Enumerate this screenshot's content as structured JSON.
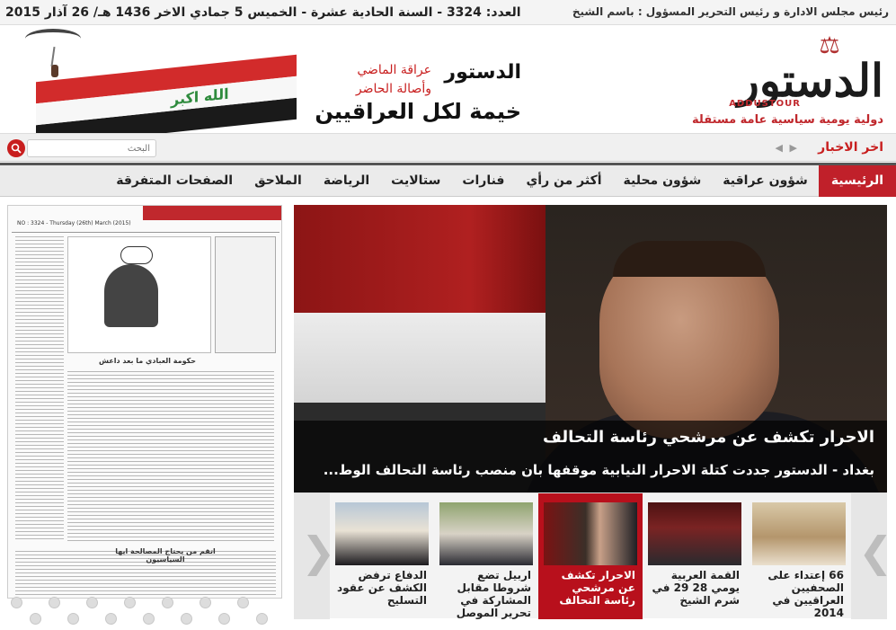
{
  "topbar": {
    "issue": "العدد: 3324 - السنة الحادية عشرة - الخميس 5 جمادي الاخر 1436 هـ/ 26 آذار 2015",
    "editor": "رئيس مجلس الادارة و رئيس التحرير المسؤول : باسم الشيخ"
  },
  "logo": {
    "main": "الدستور",
    "latin": "ADDUSTOUR",
    "tag": "دولية يومية سياسية عامة مستقلة"
  },
  "slogan": {
    "line1": "الدستور",
    "line2": "عراقة الماضي",
    "line3": "وأصالة الحاضر",
    "line4": "خيمة لكل العراقيين"
  },
  "banner": {
    "flag_text": "الله اكبر"
  },
  "ticker": {
    "label": "اخر الاخبار"
  },
  "search": {
    "placeholder": "البحث"
  },
  "nav": {
    "items": [
      {
        "label": "الرئيسية",
        "active": true
      },
      {
        "label": "شؤون عراقية"
      },
      {
        "label": "شؤون محلية"
      },
      {
        "label": "أكثر من رأي"
      },
      {
        "label": "فنارات"
      },
      {
        "label": "ستالايت"
      },
      {
        "label": "الرياضة"
      },
      {
        "label": "الملاحق"
      },
      {
        "label": "الصفحات المتفرقة"
      }
    ]
  },
  "paper": {
    "masthead": "NO : 3324 - Thursday (26th) March (2015)",
    "caption1": "حكومة العبادي ما بعد داعش",
    "caption2": "اتقم من يحتاج المصالحة ايها السياسيون"
  },
  "feature": {
    "title": "الاحرار تكشف عن مرشحي رئاسة التحالف",
    "excerpt": "بغداد - الدستور جددت كتلة الاحرار النيابية موقفها بان منصب رئاسة التحالف الوط..."
  },
  "carousel": {
    "items": [
      {
        "caption": "66 إعتداء على الصحفيين العراقيين في 2014"
      },
      {
        "caption": "القمة العربية يومي 28 29 في شرم الشيخ"
      },
      {
        "caption": "الاحرار تكشف عن مرشحي رئاسة التحالف",
        "active": true
      },
      {
        "caption": "اربيل تضع شروطا مقابل المشاركة في تحرير الموصل"
      },
      {
        "caption": "الدفاع ترفض الكشف عن عقود التسليح"
      }
    ]
  },
  "colors": {
    "brand_red": "#c0202a",
    "ticker_red": "#c81e1e",
    "active_thumb": "#b8101c"
  },
  "icons": {
    "search": "search-icon",
    "prev": "chevron-left-icon",
    "next": "chevron-right-icon"
  }
}
